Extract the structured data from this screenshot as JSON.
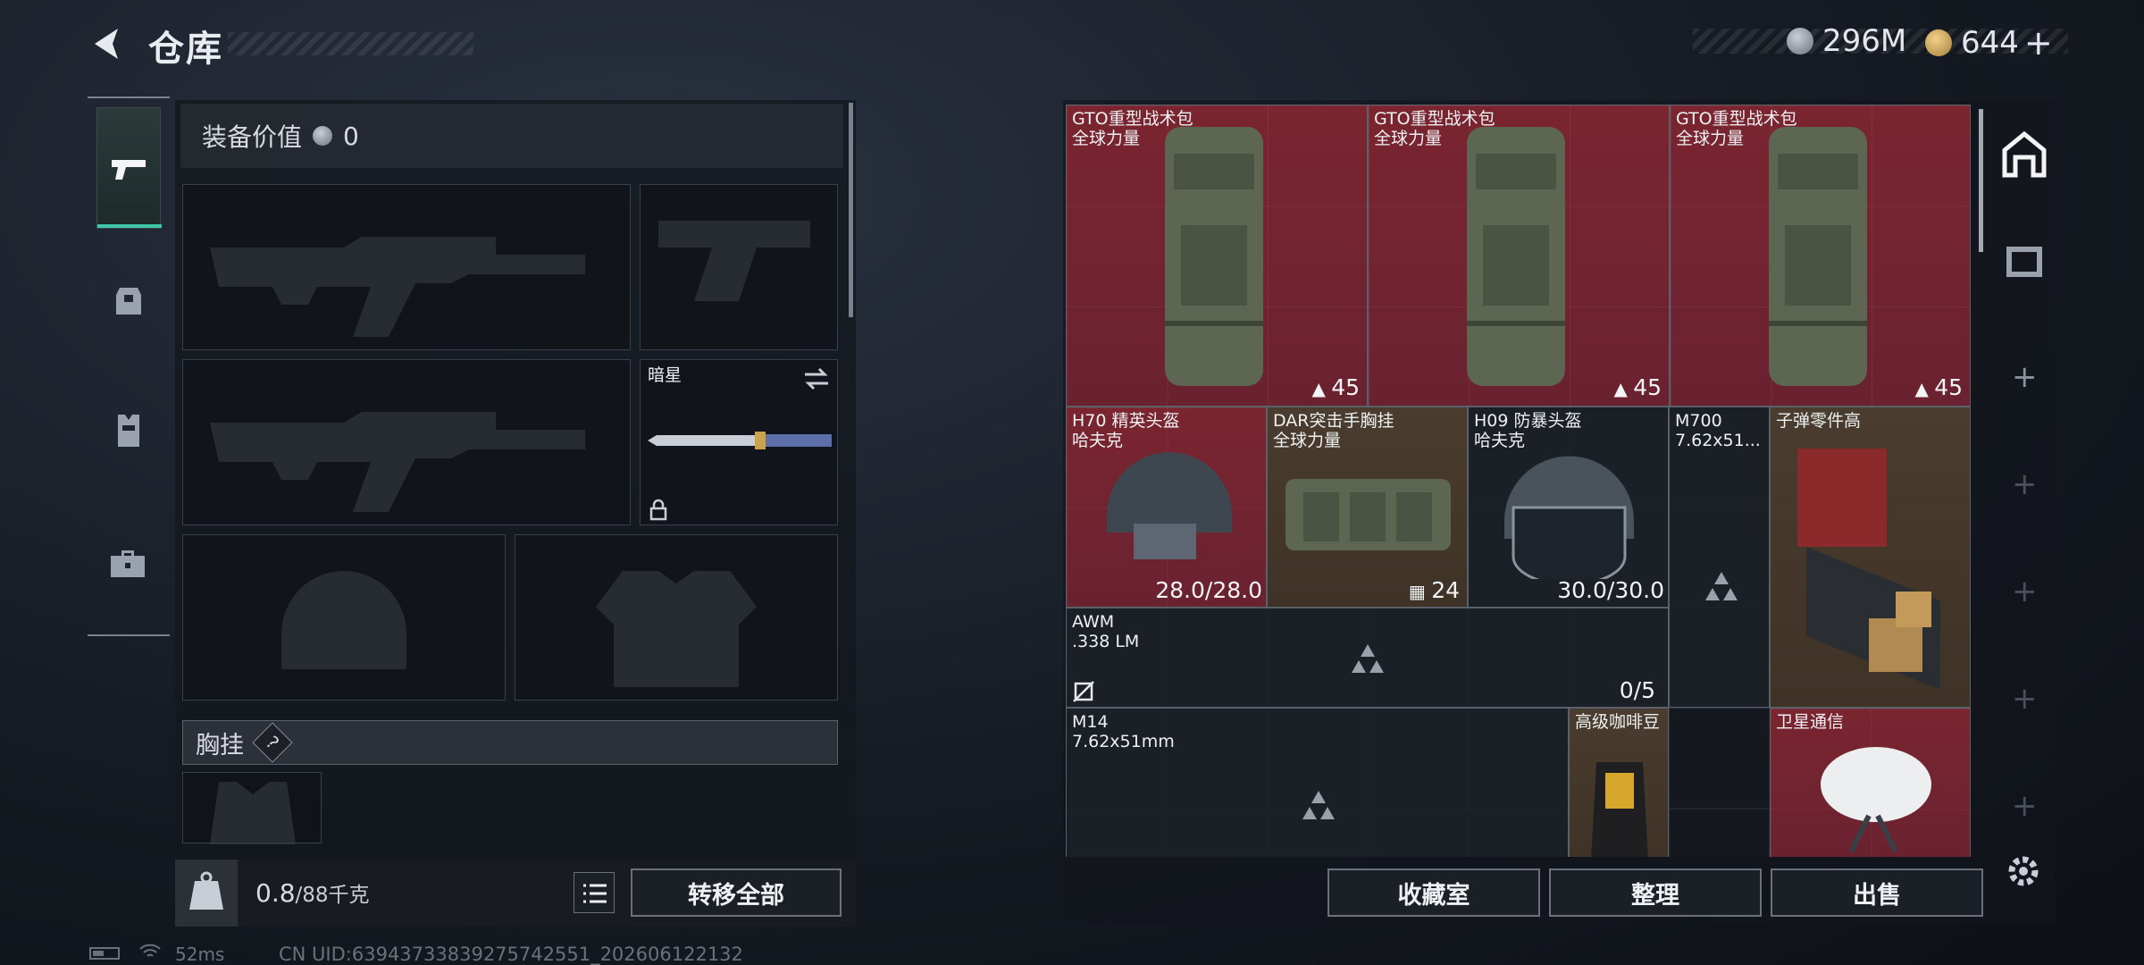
{
  "header": {
    "title": "仓库",
    "currency1": "296M",
    "currency2": "644",
    "currency2_plus": "+"
  },
  "loadout": {
    "value_label": "装备价值",
    "value": "0",
    "knife_name": "暗星",
    "chest_rig_label": "胸挂",
    "help_glyph": "?",
    "weight": "0.8",
    "weight_max": "/88千克",
    "transfer_label": "转移全部"
  },
  "status": {
    "ping": "52ms",
    "uid": "CN UID:63943733839275742551_202606122132"
  },
  "storage": {
    "items": [
      {
        "name": "GTO重型战术包",
        "sub": "全球力量",
        "count": "45"
      },
      {
        "name": "GTO重型战术包",
        "sub": "全球力量",
        "count": "45"
      },
      {
        "name": "GTO重型战术包",
        "sub": "全球力量",
        "count": "45"
      },
      {
        "name": "H70 精英头盔",
        "sub": "哈夫克",
        "durability": "28.0/28.0"
      },
      {
        "name": "DAR突击手胸挂",
        "sub": "全球力量",
        "count": "24"
      },
      {
        "name": "H09 防暴头盔",
        "sub": "哈夫克",
        "durability": "30.0/30.0"
      },
      {
        "name": "M700",
        "sub": "7.62x51..."
      },
      {
        "name": "子弹零件高"
      },
      {
        "name": "AWM",
        "sub": ".338 LM",
        "ammo": "0/5"
      },
      {
        "name": "M14",
        "sub": "7.62x51mm"
      },
      {
        "name": "高级咖啡豆"
      },
      {
        "name": "卫星通信"
      }
    ],
    "buttons": {
      "collection": "收藏室",
      "sort": "整理",
      "sell": "出售"
    }
  },
  "colors": {
    "rare_red": "#7a2530",
    "epic_brown": "#4a3c2e",
    "accent_teal": "#3fc7a8"
  }
}
